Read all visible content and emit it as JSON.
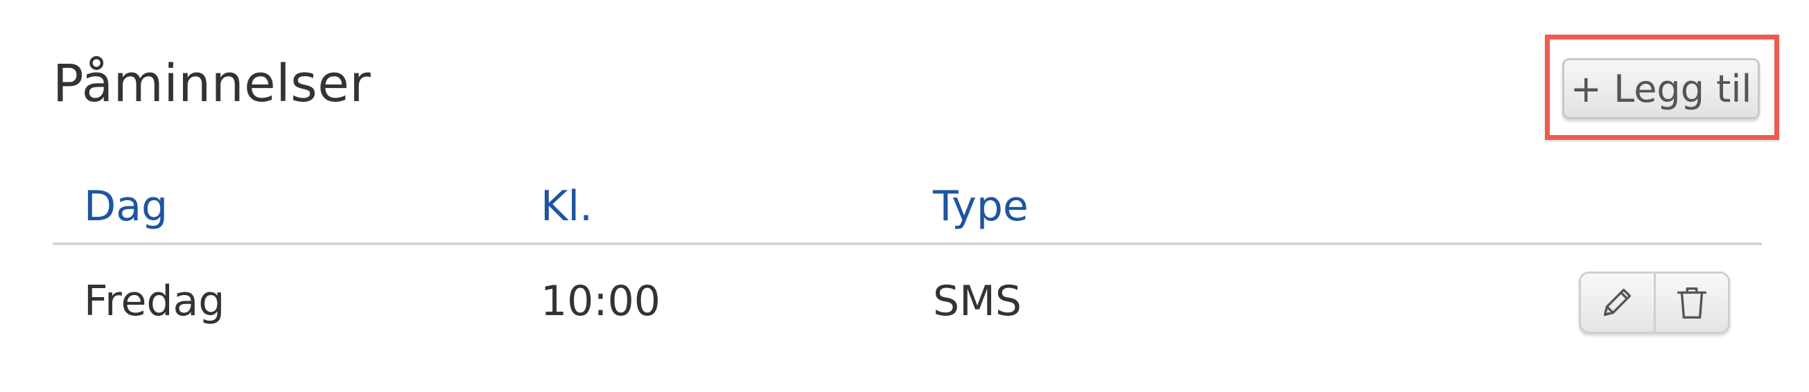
{
  "page": {
    "title": "Påminnelser"
  },
  "toolbar": {
    "add_label": "+ Legg til"
  },
  "table": {
    "columns": [
      "Dag",
      "Kl.",
      "Type"
    ],
    "rows": [
      {
        "day": "Fredag",
        "time": "10:00",
        "type": "SMS",
        "actions": [
          "pencil-icon",
          "trash-icon"
        ]
      }
    ]
  },
  "colors": {
    "header_text": "#1e55a0",
    "highlight": "#ef5a4f",
    "body_text": "#333333"
  }
}
